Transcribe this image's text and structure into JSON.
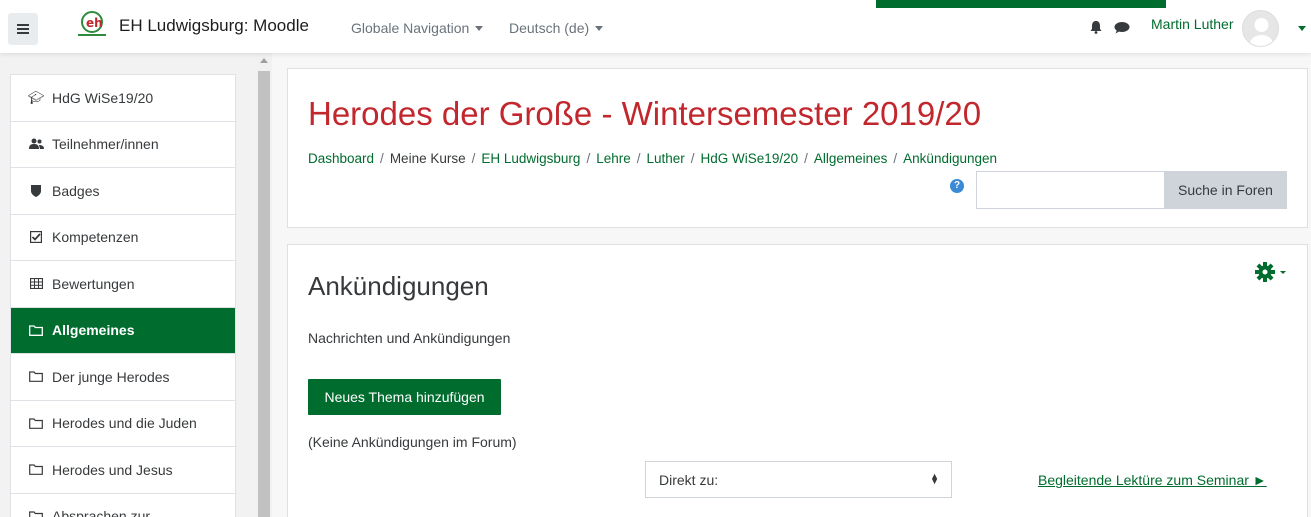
{
  "navbar": {
    "site_name": "EH Ludwigsburg: Moodle",
    "global_nav": "Globale Navigation",
    "language": "Deutsch (de)",
    "user_name": "Martin Luther"
  },
  "sidebar": {
    "items": [
      {
        "label": "HdG WiSe19/20",
        "icon": "graduation-cap-icon"
      },
      {
        "label": "Teilnehmer/innen",
        "icon": "users-icon"
      },
      {
        "label": "Badges",
        "icon": "shield-icon"
      },
      {
        "label": "Kompetenzen",
        "icon": "checkbox-icon"
      },
      {
        "label": "Bewertungen",
        "icon": "table-icon"
      },
      {
        "label": "Allgemeines",
        "icon": "folder-icon",
        "active": true
      },
      {
        "label": "Der junge Herodes",
        "icon": "folder-icon"
      },
      {
        "label": "Herodes und die Juden",
        "icon": "folder-icon"
      },
      {
        "label": "Herodes und Jesus",
        "icon": "folder-icon"
      },
      {
        "label": "Absprachen zur",
        "icon": "folder-icon"
      }
    ]
  },
  "header": {
    "title": "Herodes der Große - Wintersemester 2019/20",
    "breadcrumb": [
      "Dashboard",
      "Meine Kurse",
      "EH Ludwigsburg",
      "Lehre",
      "Luther",
      "HdG WiSe19/20",
      "Allgemeines",
      "Ankündigungen"
    ],
    "search_button": "Suche in Foren",
    "search_value": "",
    "help_icon": "?"
  },
  "forum": {
    "title": "Ankündigungen",
    "intro": "Nachrichten und Ankündigungen",
    "new_topic_button": "Neues Thema hinzufügen",
    "no_posts": "(Keine Ankündigungen im Forum)",
    "jump_to": "Direkt zu:",
    "next_link": "Begleitende Lektüre zum Seminar ►"
  },
  "colors": {
    "brand_green": "#006c2e",
    "title_red": "#c1272d"
  }
}
